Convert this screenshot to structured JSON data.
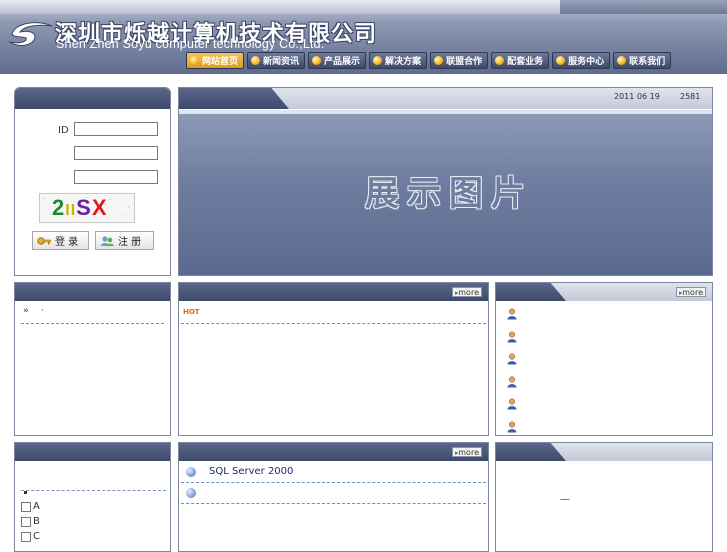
{
  "header": {
    "company_cn": "深圳市烁越计算机技术有限公司",
    "company_en": "Shen Zhen Soyu computer technology Co.,Ltd."
  },
  "nav": [
    {
      "label": "网站首页",
      "active": true
    },
    {
      "label": "新闻资讯",
      "active": false
    },
    {
      "label": "产品展示",
      "active": false
    },
    {
      "label": "解决方案",
      "active": false
    },
    {
      "label": "联盟合作",
      "active": false
    },
    {
      "label": "配套业务",
      "active": false
    },
    {
      "label": "服务中心",
      "active": false
    },
    {
      "label": "联系我们",
      "active": false
    }
  ],
  "login": {
    "id_label": "ID",
    "id_value": "",
    "password_value": "",
    "captcha_input_value": "",
    "captcha_text": "2IISX",
    "login_label": "登 录",
    "register_label": "注 册"
  },
  "banner": {
    "date": "2011 06 19",
    "counter": "2581",
    "title": "展示图片"
  },
  "more_label": "more",
  "left_panel": {
    "bullet": "»",
    "item_text": "·"
  },
  "middle_panel": {
    "hot_tag": "HOT"
  },
  "right_panel": {
    "people_count": 6
  },
  "survey": {
    "options": [
      "A",
      "B",
      "C"
    ]
  },
  "bottom_mid": {
    "items": [
      "SQL Server 2000",
      ""
    ]
  },
  "bottom_right": {
    "link": "—"
  },
  "colors": {
    "panel_title": "#4a5678",
    "nav_active": "#eaa62a",
    "dash": "#6b8fc8",
    "hot": "#e36a00"
  }
}
